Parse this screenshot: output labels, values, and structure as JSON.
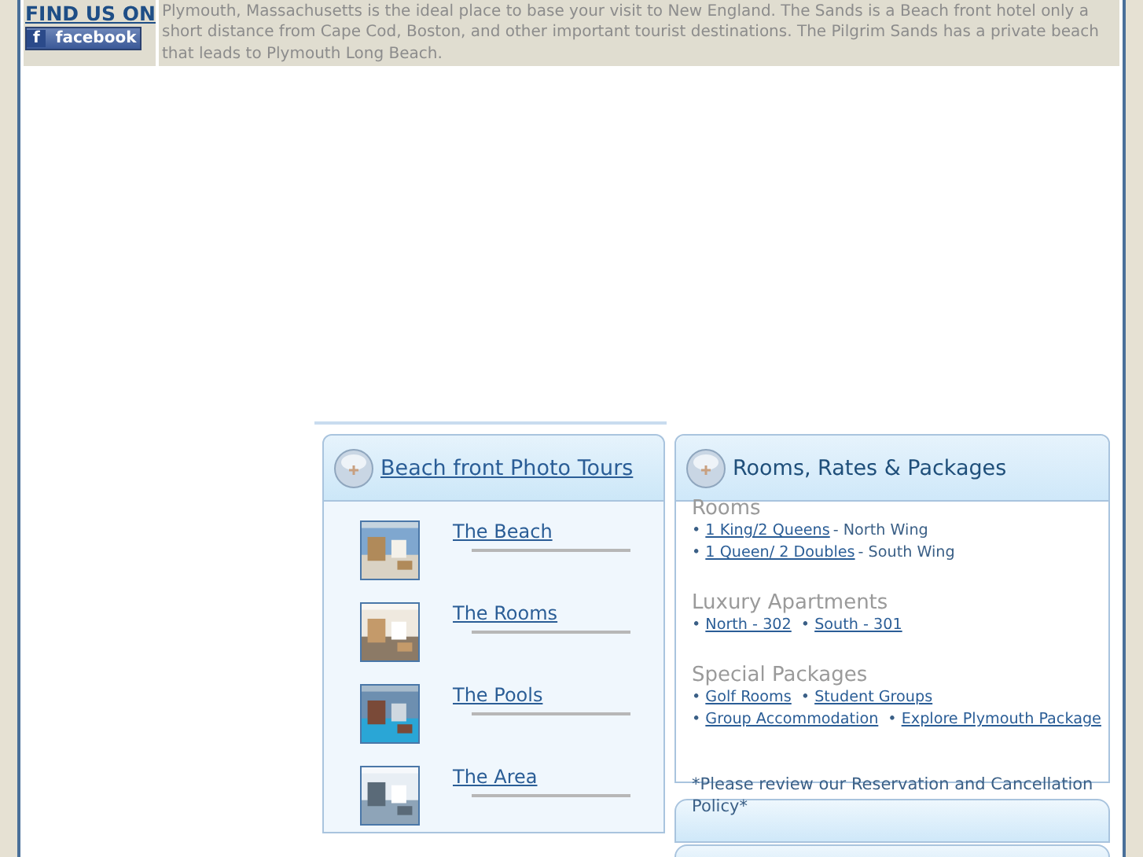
{
  "find_us": {
    "heading": "FIND US ON",
    "logo_letter": "f",
    "button": "facebook"
  },
  "intro": "Plymouth, Massachusetts is the ideal place to base your visit to New England. The Sands is a Beach front hotel only a short distance from Cape Cod, Boston, and other important tourist destinations. The Pilgrim Sands has a private beach that leads to Plymouth Long Beach.",
  "photo_tours": {
    "title": "Beach front Photo Tours",
    "items": [
      {
        "label": "The Beach",
        "kind": "picture"
      },
      {
        "label": "The Rooms",
        "kind": "picture"
      },
      {
        "label": "The Pools",
        "kind": "picture"
      },
      {
        "label": "The Area",
        "kind": "picture"
      }
    ]
  },
  "rooms_panel": {
    "title": "Rooms, Rates & Packages",
    "sections": [
      {
        "heading": "Rooms",
        "lines": [
          [
            {
              "kind": "bullet",
              "text": "•"
            },
            {
              "kind": "link",
              "text": "1 King/2 Queens"
            },
            {
              "kind": "text",
              "text": "- North Wing"
            }
          ],
          [
            {
              "kind": "bullet",
              "text": "•"
            },
            {
              "kind": "link",
              "text": "1 Queen/ 2 Doubles"
            },
            {
              "kind": "text",
              "text": "- South Wing"
            }
          ]
        ]
      },
      {
        "heading": "Luxury Apartments",
        "lines": [
          [
            {
              "kind": "bullet",
              "text": "•"
            },
            {
              "kind": "link",
              "text": "North - 302"
            },
            {
              "kind": "bullet",
              "text": "•"
            },
            {
              "kind": "link",
              "text": "South - 301"
            }
          ]
        ]
      },
      {
        "heading": "Special Packages",
        "lines": [
          [
            {
              "kind": "bullet",
              "text": "•"
            },
            {
              "kind": "link",
              "text": "Golf Rooms"
            },
            {
              "kind": "bullet",
              "text": "•"
            },
            {
              "kind": "link",
              "text": "Student Groups"
            }
          ],
          [
            {
              "kind": "bullet",
              "text": "•"
            },
            {
              "kind": "link",
              "text": "Group Accommodation"
            },
            {
              "kind": "bullet",
              "text": "•"
            },
            {
              "kind": "link",
              "text": "Explore Plymouth Package"
            }
          ]
        ]
      }
    ],
    "note": "*Please review our Reservation and Cancellation Policy*"
  }
}
